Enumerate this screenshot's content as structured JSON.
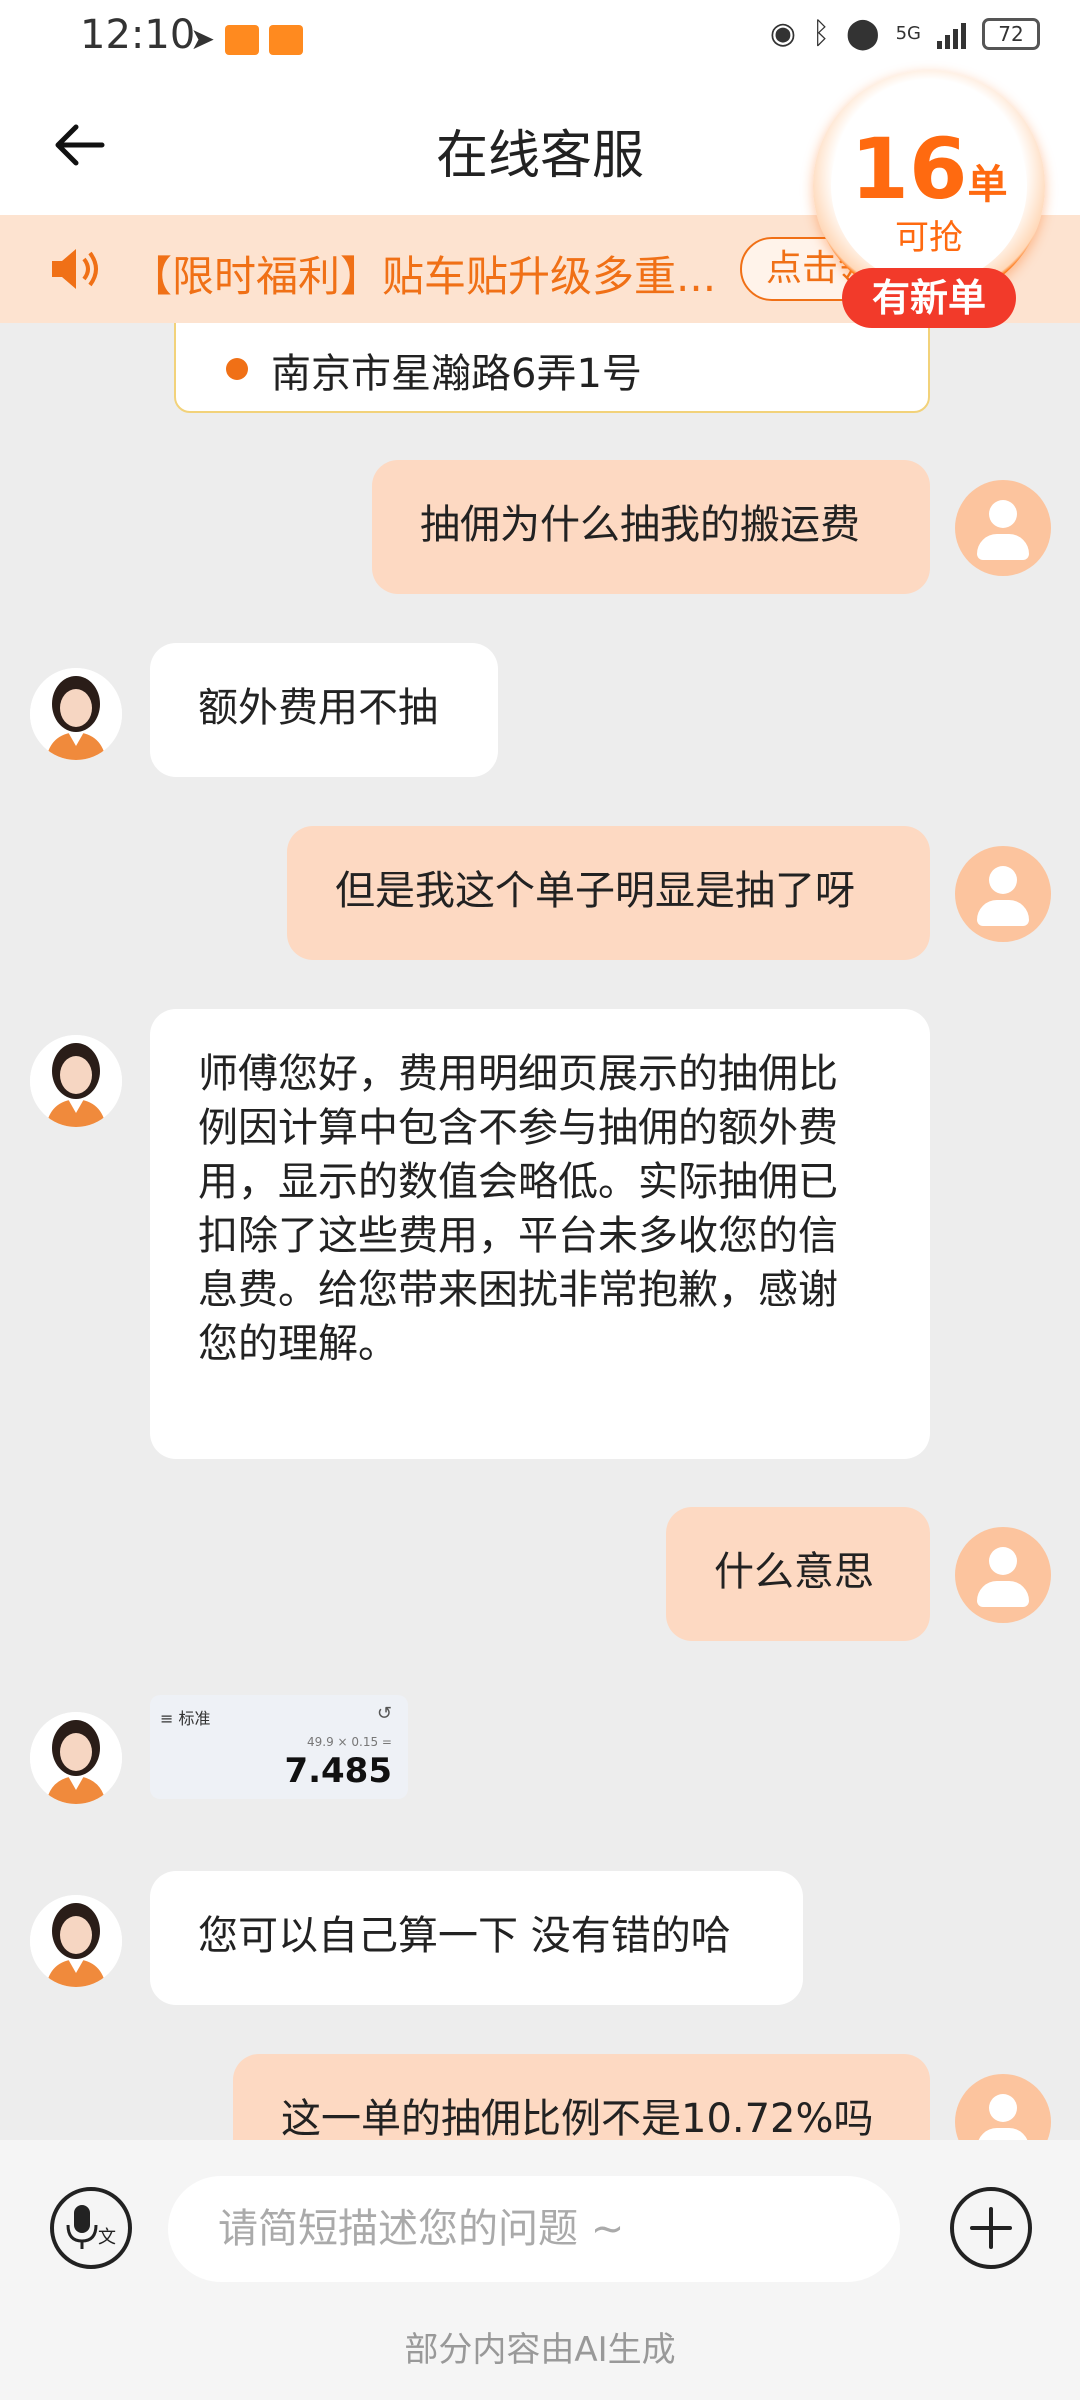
{
  "status_bar": {
    "time": "12:10",
    "network": "5G",
    "battery": "72"
  },
  "header": {
    "title": "在线客服"
  },
  "notice": {
    "text": "【限时福利】贴车贴升级多重...",
    "button": "点击领"
  },
  "order_badge": {
    "count": "16",
    "unit": "单",
    "sub": "可抢",
    "new_label": "有新单"
  },
  "address": {
    "text": "南京市星瀚路6弄1号"
  },
  "messages": [
    {
      "from": "user",
      "text": "抽佣为什么抽我的搬运费"
    },
    {
      "from": "agent",
      "text": "额外费用不抽"
    },
    {
      "from": "user",
      "text": "但是我这个单子明显是抽了呀"
    },
    {
      "from": "agent",
      "lines": [
        " 师傅您好，费用明细页展示的抽佣比",
        "例因计算中包含不参与抽佣的额外费",
        "用，显示的数值会略低。实际抽佣已",
        "扣除了这些费用，平台未多收您的信",
        "息费。给您带来困扰非常抱歉，感谢",
        "您的理解。"
      ]
    },
    {
      "from": "user",
      "text": "什么意思"
    },
    {
      "from": "agent",
      "text": "您可以自己算一下 没有错的哈"
    },
    {
      "from": "user",
      "text": "这一单的抽佣比例不是10.72%吗"
    }
  ],
  "calc_image": {
    "mode": "标准",
    "expression": "49.9 × 0.15 =",
    "result": "7.485"
  },
  "input": {
    "placeholder": "请简短描述您的问题 ~"
  },
  "footer": {
    "ai_note": "部分内容由AI生成"
  },
  "colors": {
    "accent": "#f07016",
    "user_bubble": "#fdd9c2",
    "badge_red": "#f23a2a"
  }
}
